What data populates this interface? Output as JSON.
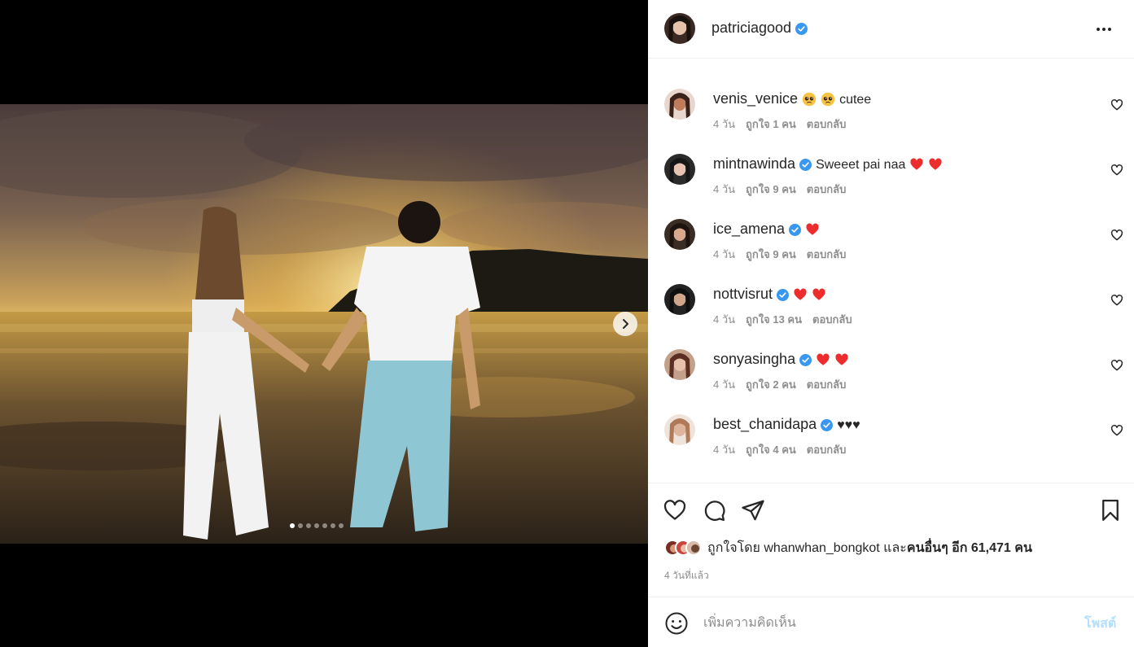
{
  "post": {
    "author": "patriciagood",
    "author_verified": true,
    "carousel": {
      "total": 7,
      "active_index": 0
    }
  },
  "colors": {
    "verified": "#3897f0",
    "heart_red": "#ed4956",
    "post_disabled": "#b2dffc",
    "meta_gray": "#8e8e8e"
  },
  "comments": [
    {
      "user": "venis_venice",
      "verified": false,
      "emoji": [
        "pleading-face",
        "pleading-face"
      ],
      "text": "cutee",
      "age": "4 วัน",
      "likes": "ถูกใจ 1 คน",
      "reply": "ตอบกลับ"
    },
    {
      "user": "mintnawinda",
      "verified": true,
      "text": "Sweeet pai naa",
      "emoji_after": [
        "red-heart",
        "red-heart"
      ],
      "age": "4 วัน",
      "likes": "ถูกใจ 9 คน",
      "reply": "ตอบกลับ"
    },
    {
      "user": "ice_amena",
      "verified": true,
      "emoji_after": [
        "red-heart"
      ],
      "age": "4 วัน",
      "likes": "ถูกใจ 9 คน",
      "reply": "ตอบกลับ"
    },
    {
      "user": "nottvisrut",
      "verified": true,
      "emoji_after": [
        "red-heart",
        "red-heart"
      ],
      "age": "4 วัน",
      "likes": "ถูกใจ 13 คน",
      "reply": "ตอบกลับ"
    },
    {
      "user": "sonyasingha",
      "verified": true,
      "emoji_after": [
        "red-heart",
        "red-heart"
      ],
      "age": "4 วัน",
      "likes": "ถูกใจ 2 คน",
      "reply": "ตอบกลับ"
    },
    {
      "user": "best_chanidapa",
      "verified": true,
      "text": "♥♥♥",
      "age": "4 วัน",
      "likes": "ถูกใจ 4 คน",
      "reply": "ตอบกลับ"
    }
  ],
  "likes": {
    "prefix": "ถูกใจโดย",
    "user": "whanwhan_bongkot",
    "connector": "และ",
    "others": "คนอื่นๆ อีก 61,471 คน"
  },
  "posted_ago": "4 วันที่แล้ว",
  "comment_box": {
    "placeholder": "เพิ่มความคิดเห็น",
    "post_label": "โพสต์"
  },
  "icons": [
    "verified-icon",
    "more-icon",
    "heart-icon",
    "comment-icon",
    "share-icon",
    "bookmark-icon",
    "smile-icon",
    "chevron-right-icon"
  ]
}
